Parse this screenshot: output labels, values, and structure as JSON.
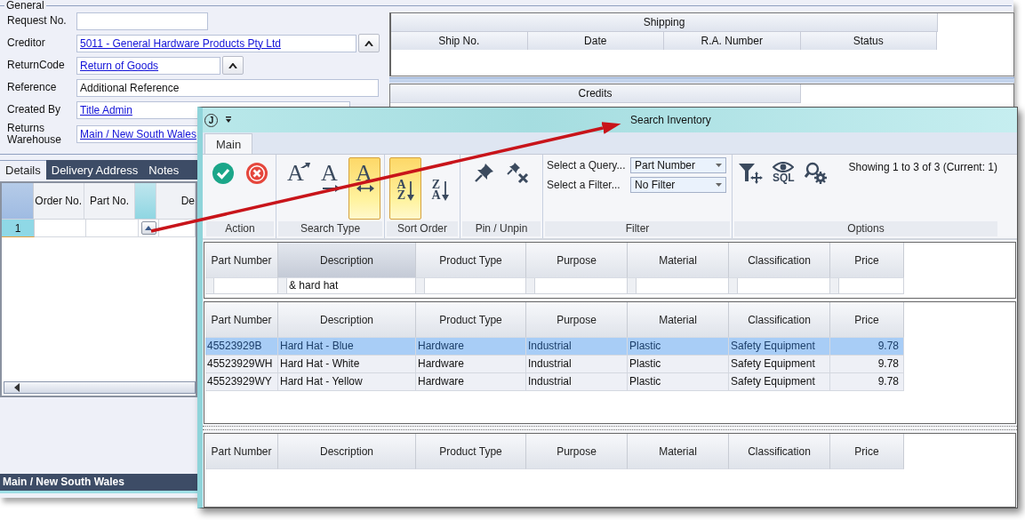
{
  "main_window": {
    "general": {
      "legend": "General",
      "fields": [
        {
          "label": "Request No.",
          "kind": "text",
          "lookup": false
        },
        {
          "label": "Creditor",
          "kind": "link",
          "value": "5011 - General Hardware Products Pty Ltd",
          "lookup": true
        },
        {
          "label": "ReturnCode",
          "kind": "link",
          "value": "Return of Goods",
          "lookup": true
        },
        {
          "label": "Reference",
          "kind": "text",
          "value": "Additional Reference",
          "lookup": false
        },
        {
          "label": "Created By",
          "kind": "link",
          "value": "Title Admin",
          "lookup": false
        },
        {
          "label": "Returns Warehouse",
          "kind": "link",
          "value": "Main / New South Wales",
          "lookup": false
        }
      ]
    },
    "tabs": [
      {
        "label": "Details",
        "selected": true
      },
      {
        "label": "Delivery Address",
        "selected": false
      },
      {
        "label": "Notes",
        "selected": false
      }
    ],
    "details_grid": {
      "columns": [
        {
          "kind": "text",
          "label": "Order No."
        },
        {
          "kind": "text",
          "label": "Part No."
        },
        {
          "kind": "lookup"
        },
        {
          "kind": "text",
          "label": "De"
        }
      ],
      "rows": [
        {
          "number": "1",
          "selected": true
        }
      ]
    },
    "shipping": {
      "title": "Shipping",
      "columns": [
        "Ship No.",
        "Date",
        "R.A. Number",
        "Status"
      ]
    },
    "credits": {
      "title": "Credits"
    },
    "status_bar": "Main / New South Wales"
  },
  "dialog": {
    "app_icon": "J",
    "title": "Search Inventory",
    "tabs": [
      {
        "label": "Main",
        "selected": true
      }
    ],
    "ribbon": [
      {
        "label": "Action",
        "items": [
          {
            "kind": "check",
            "selected": false
          },
          {
            "kind": "cross",
            "selected": false
          }
        ]
      },
      {
        "label": "Search Type",
        "items": [
          {
            "kind": "letter-up",
            "glyph": "A",
            "selected": false
          },
          {
            "kind": "letter-right",
            "glyph": "A",
            "selected": false
          },
          {
            "kind": "letter-both",
            "glyph": "A",
            "selected": true
          }
        ]
      },
      {
        "label": "Sort Order",
        "items": [
          {
            "kind": "sort",
            "glyphs": [
              "A",
              "Z"
            ],
            "selected": true
          },
          {
            "kind": "sort",
            "glyphs": [
              "Z",
              "A"
            ],
            "selected": false
          }
        ]
      },
      {
        "label": "Pin / Unpin",
        "items": [
          {
            "kind": "pin",
            "selected": false
          },
          {
            "kind": "unpin",
            "selected": false
          }
        ]
      },
      {
        "label": "Filter",
        "items": [
          {
            "kind": "dropdown",
            "label": "Select a Query...",
            "value": "Part Number"
          },
          {
            "kind": "dropdown",
            "label": "Select a Filter...",
            "value": "No Filter"
          }
        ]
      },
      {
        "label": "Options",
        "items": [
          {
            "kind": "filter-add",
            "selected": false
          },
          {
            "kind": "sql",
            "glyph": "SQL",
            "selected": false
          },
          {
            "kind": "search-settings",
            "selected": false
          },
          {
            "kind": "status",
            "text": "Showing 1 to 3 of 3 (Current: 1)"
          }
        ]
      }
    ],
    "filter_grid": {
      "columns": [
        {
          "label": "Part Number",
          "selected": false
        },
        {
          "label": "Description",
          "selected": true,
          "filter": "& hard hat"
        },
        {
          "label": "Product Type",
          "selected": false
        },
        {
          "label": "Purpose",
          "selected": false
        },
        {
          "label": "Material",
          "selected": false
        },
        {
          "label": "Classification",
          "selected": false
        },
        {
          "label": "Price",
          "selected": false
        }
      ]
    },
    "results_grid": {
      "columns": [
        {
          "label": "Part Number",
          "kind": "text"
        },
        {
          "label": "Description",
          "kind": "text"
        },
        {
          "label": "Product Type",
          "kind": "text"
        },
        {
          "label": "Purpose",
          "kind": "text"
        },
        {
          "label": "Material",
          "kind": "text"
        },
        {
          "label": "Classification",
          "kind": "text"
        },
        {
          "label": "Price",
          "kind": "number"
        }
      ],
      "rows": [
        {
          "selected": true,
          "cells": [
            "45523929B",
            "Hard Hat - Blue",
            "Hardware",
            "Industrial",
            "Plastic",
            "Safety Equipment",
            "9.78"
          ]
        },
        {
          "selected": false,
          "cells": [
            "45523929WH",
            "Hard Hat - White",
            "Hardware",
            "Industrial",
            "Plastic",
            "Safety Equipment",
            "9.78"
          ]
        },
        {
          "selected": false,
          "cells": [
            "45523929WY",
            "Hard Hat - Yellow",
            "Hardware",
            "Industrial",
            "Plastic",
            "Safety Equipment",
            "9.78"
          ]
        }
      ]
    },
    "detail_grid": {
      "columns": [
        "Part Number",
        "Description",
        "Product Type",
        "Purpose",
        "Material",
        "Classification",
        "Price"
      ]
    }
  }
}
